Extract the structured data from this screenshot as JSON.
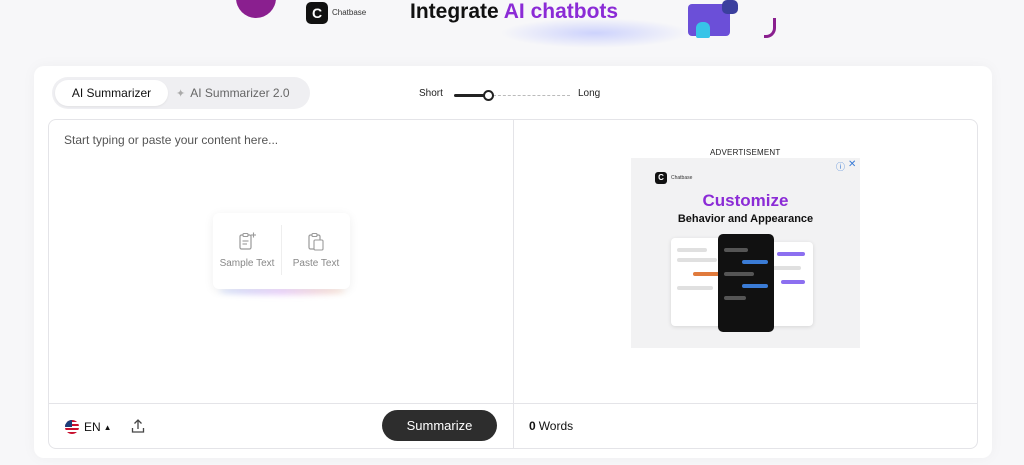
{
  "banner": {
    "brand": "Chatbase",
    "headline_prefix": "Integrate ",
    "headline_accent": "AI chatbots",
    "logo_letter": "C",
    "accent_color": "#8b2bd6"
  },
  "tabs": [
    {
      "label": "AI Summarizer",
      "active": true
    },
    {
      "label": "AI Summarizer 2.0",
      "active": false,
      "icon": "sparkle-icon"
    }
  ],
  "length": {
    "short_label": "Short",
    "long_label": "Long",
    "value": 0.3
  },
  "editor": {
    "placeholder": "Start typing or paste your content here...",
    "sample_text_label": "Sample Text",
    "paste_text_label": "Paste Text"
  },
  "footer": {
    "language": "EN",
    "language_flag": "us-flag-icon",
    "upload_icon": "upload-icon",
    "summarize_label": "Summarize",
    "word_count": "0",
    "words_label": "Words"
  },
  "ad": {
    "label": "ADVERTISEMENT",
    "brand": "Chatbase",
    "logo_letter": "C",
    "title": "Customize",
    "subtitle": "Behavior and Appearance",
    "info_icon": "ⓘ",
    "close_icon": "✕"
  }
}
